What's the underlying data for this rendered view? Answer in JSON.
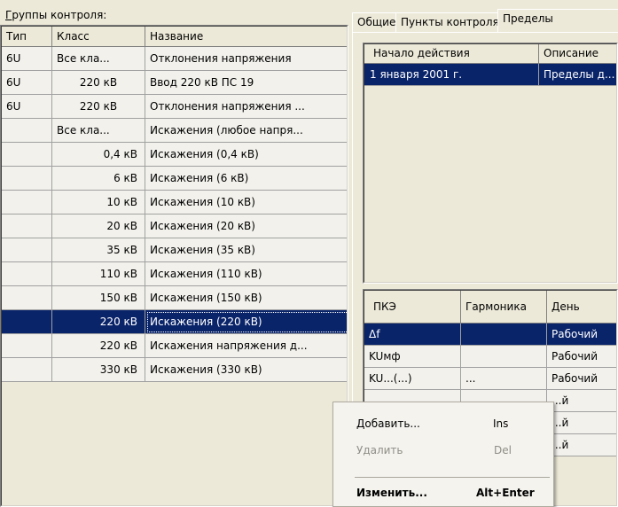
{
  "groups_label": {
    "underline": "Г",
    "rest": "руппы контроля:"
  },
  "left_grid": {
    "headers": [
      "Тип",
      "Класс",
      "Название"
    ],
    "rows": [
      {
        "type": "6U",
        "cls": "Все кла...",
        "name": "Отклонения напряжения",
        "cls_align": "left"
      },
      {
        "type": "6U",
        "cls": "220 кВ",
        "name": "Ввод 220 кВ ПС 19",
        "cls_align": "center"
      },
      {
        "type": "6U",
        "cls": "220 кВ",
        "name": "Отклонения напряжения ...",
        "cls_align": "center"
      },
      {
        "type": "",
        "cls": "Все кла...",
        "name": "Искажения (любое напря...",
        "cls_align": "left"
      },
      {
        "type": "",
        "cls": "0,4 кВ",
        "name": "Искажения (0,4 кВ)",
        "cls_align": "right"
      },
      {
        "type": "",
        "cls": "6 кВ",
        "name": "Искажения (6 кВ)",
        "cls_align": "right"
      },
      {
        "type": "",
        "cls": "10 кВ",
        "name": "Искажения (10 кВ)",
        "cls_align": "right"
      },
      {
        "type": "",
        "cls": "20 кВ",
        "name": "Искажения (20 кВ)",
        "cls_align": "right"
      },
      {
        "type": "",
        "cls": "35 кВ",
        "name": "Искажения (35 кВ)",
        "cls_align": "right"
      },
      {
        "type": "",
        "cls": "110 кВ",
        "name": "Искажения (110 кВ)",
        "cls_align": "right"
      },
      {
        "type": "",
        "cls": "150 кВ",
        "name": "Искажения (150 кВ)",
        "cls_align": "right"
      },
      {
        "type": "",
        "cls": "220 кВ",
        "name": "Искажения (220 кВ)",
        "cls_align": "right",
        "selected": true
      },
      {
        "type": "",
        "cls": "220 кВ",
        "name": "Искажения напряжения д...",
        "cls_align": "right"
      },
      {
        "type": "",
        "cls": "330 кВ",
        "name": "Искажения (330 кВ)",
        "cls_align": "right"
      }
    ]
  },
  "tabs": [
    "Общие",
    "Пункты контроля",
    "Пределы"
  ],
  "active_tab": 2,
  "periods_grid": {
    "headers": [
      "Начало действия",
      "Описание"
    ],
    "rows": [
      {
        "start": "1 января 2001 г.",
        "desc": "Пределы д..."
      }
    ]
  },
  "pke_grid": {
    "headers": [
      "ПКЭ",
      "Гармоника",
      "День"
    ],
    "rows": [
      {
        "pke": "Δf",
        "harm": "",
        "day": "Рабочий",
        "selected": true
      },
      {
        "pke": "KUмф",
        "harm": "",
        "day": "Рабочий"
      },
      {
        "pke": "KU...(...)",
        "harm": "...",
        "day": "Рабочий"
      },
      {
        "pke": "",
        "harm": "",
        "day": "...й"
      },
      {
        "pke": "",
        "harm": "",
        "day": "...й"
      },
      {
        "pke": "",
        "harm": "",
        "day": "...й"
      }
    ]
  },
  "context_menu": {
    "items": [
      {
        "label": "Добавить...",
        "key": "Ins"
      },
      {
        "label": "Удалить",
        "key": "Del",
        "disabled": true
      },
      {
        "label": "Изменить...",
        "key": "Alt+Enter",
        "bold": true
      }
    ]
  }
}
